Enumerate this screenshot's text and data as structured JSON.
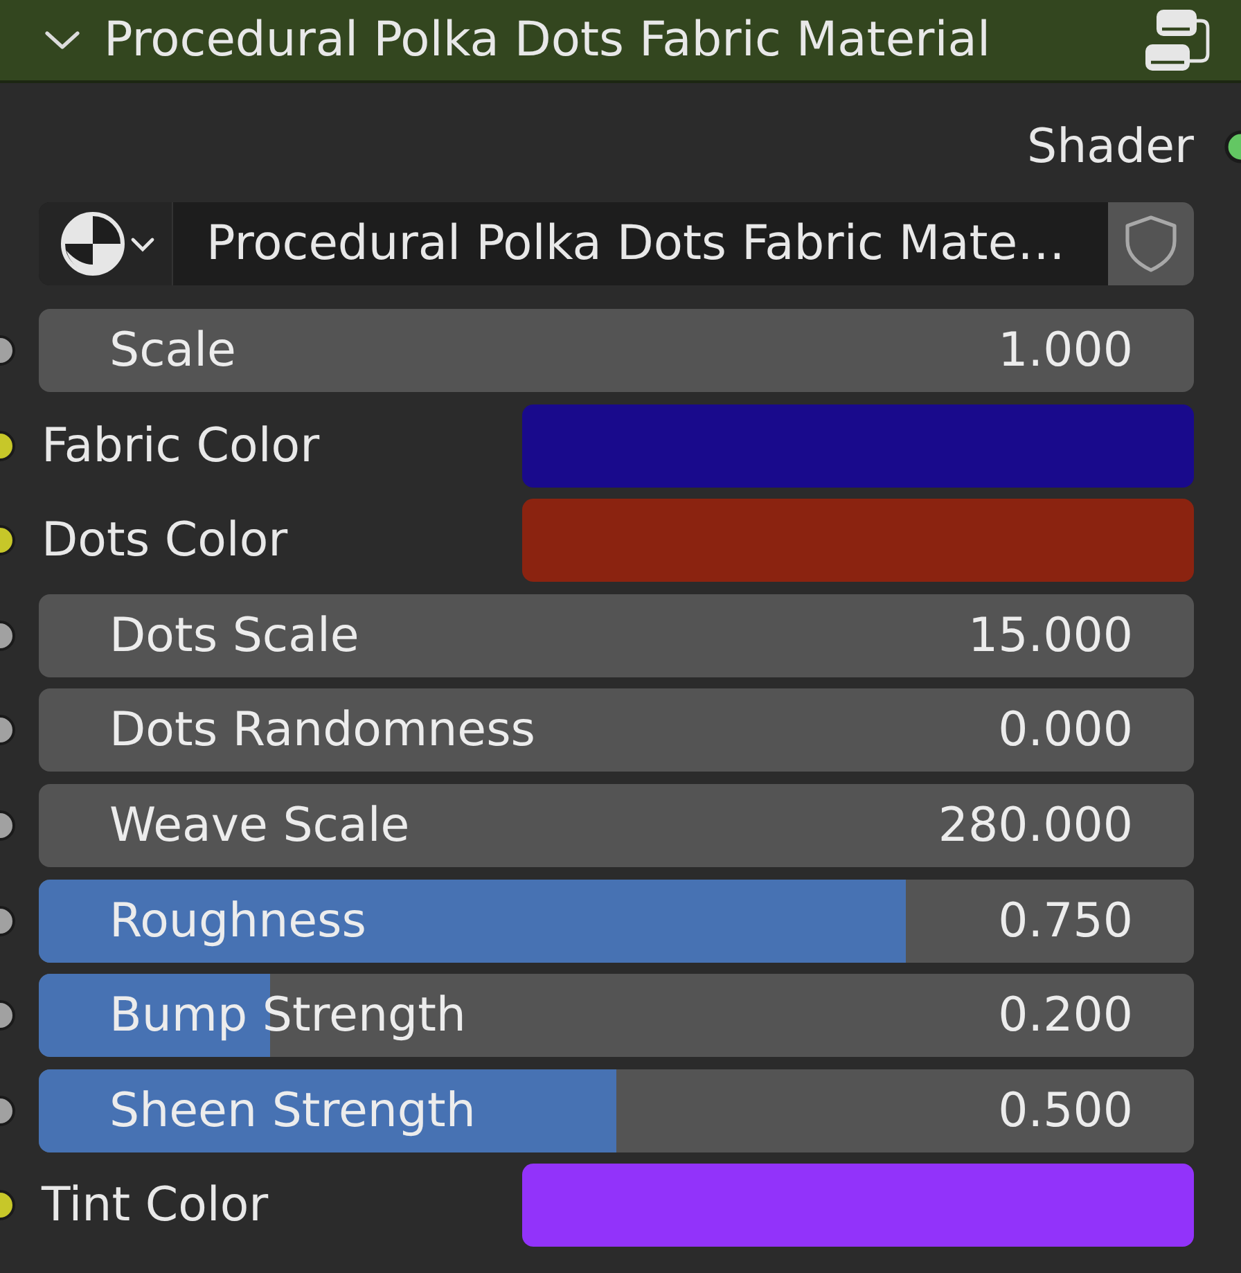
{
  "node": {
    "title": "Procedural Polka Dots Fabric Material",
    "expanded": true
  },
  "output": {
    "label": "Shader"
  },
  "material": {
    "name": "Procedural Polka Dots Fabric Mate…"
  },
  "inputs": [
    {
      "kind": "number",
      "label": "Scale",
      "value": "1.000"
    },
    {
      "kind": "color",
      "label": "Fabric Color",
      "color": "#190a8c"
    },
    {
      "kind": "color",
      "label": "Dots Color",
      "color": "#8b2310"
    },
    {
      "kind": "number",
      "label": "Dots Scale",
      "value": "15.000"
    },
    {
      "kind": "number",
      "label": "Dots Randomness",
      "value": "0.000"
    },
    {
      "kind": "number",
      "label": "Weave Scale",
      "value": "280.000"
    },
    {
      "kind": "slider",
      "label": "Roughness",
      "value": "0.750",
      "level": 0.75
    },
    {
      "kind": "slider",
      "label": "Bump Strength",
      "value": "0.200",
      "level": 0.2
    },
    {
      "kind": "slider",
      "label": "Sheen Strength",
      "value": "0.500",
      "level": 0.5
    },
    {
      "kind": "color",
      "label": "Tint Color",
      "color": "#9233fa"
    }
  ]
}
